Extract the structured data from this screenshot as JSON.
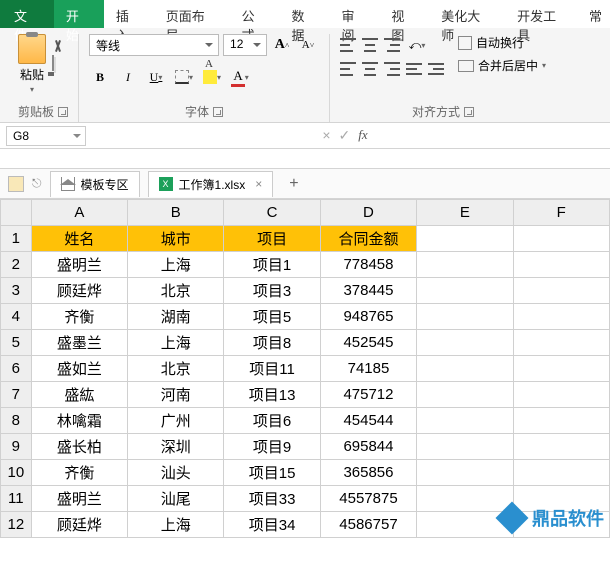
{
  "ribbon": {
    "tabs": [
      "文件",
      "开始",
      "插入",
      "页面布局",
      "公式",
      "数据",
      "审阅",
      "视图",
      "美化大师",
      "开发工具",
      "常"
    ],
    "activeTab": "开始"
  },
  "groups": {
    "clipboard": {
      "paste": "粘贴",
      "label": "剪贴板"
    },
    "font": {
      "name": "等线",
      "size": "12",
      "label": "字体",
      "B": "B",
      "I": "I",
      "U": "U",
      "A_big": "A",
      "A_small": "A"
    },
    "align": {
      "wrap": "自动换行",
      "merge": "合并后居中",
      "label": "对齐方式"
    }
  },
  "cellref": {
    "name": "G8",
    "fx": "fx"
  },
  "doctabs": {
    "template": "模板专区",
    "workbook": "工作簿1.xlsx",
    "xlsLabel": "X"
  },
  "chart_data": {
    "type": "table",
    "columns": [
      "A",
      "B",
      "C",
      "D",
      "E",
      "F"
    ],
    "headers": [
      "姓名",
      "城市",
      "项目",
      "合同金额"
    ],
    "rows": [
      [
        "盛明兰",
        "上海",
        "项目1",
        "778458"
      ],
      [
        "顾廷烨",
        "北京",
        "项目3",
        "378445"
      ],
      [
        "齐衡",
        "湖南",
        "项目5",
        "948765"
      ],
      [
        "盛墨兰",
        "上海",
        "项目8",
        "452545"
      ],
      [
        "盛如兰",
        "北京",
        "项目11",
        "74185"
      ],
      [
        "盛紘",
        "河南",
        "项目13",
        "475712"
      ],
      [
        "林噙霜",
        "广州",
        "项目6",
        "454544"
      ],
      [
        "盛长柏",
        "深圳",
        "项目9",
        "695844"
      ],
      [
        "齐衡",
        "汕头",
        "项目15",
        "365856"
      ],
      [
        "盛明兰",
        "汕尾",
        "项目33",
        "4557875"
      ],
      [
        "顾廷烨",
        "上海",
        "项目34",
        "4586757"
      ]
    ]
  },
  "watermark": "鼎品软件"
}
